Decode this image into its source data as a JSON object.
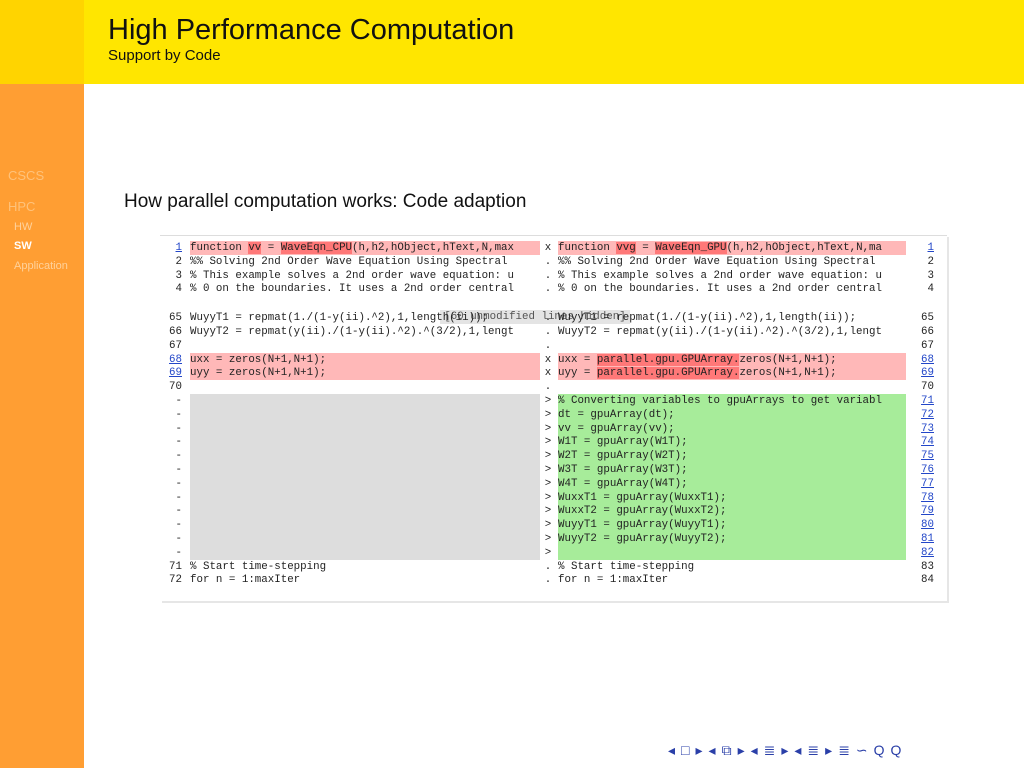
{
  "header": {
    "title": "High Performance Computation",
    "subtitle": "Support by Code"
  },
  "nav": {
    "sections": [
      "CSCS",
      "HPC"
    ],
    "subsections": [
      "HW",
      "SW",
      "Application"
    ],
    "active": "SW"
  },
  "frame": {
    "heading": "How parallel computation works: Code adaption"
  },
  "diff": {
    "hidden_note": "[60 unmodified lines hidden]",
    "rows": [
      {
        "l": "1",
        "lt": "function vv = WaveEqn_CPU(h,h2,hObject,hText,N,max",
        "m": "x",
        "rt": "function vvg = WaveEqn_GPU(h,h2,hObject,hText,N,ma",
        "r": "1"
      },
      {
        "l": "2",
        "lt": "%% Solving 2nd Order Wave Equation Using Spectral",
        "m": ".",
        "rt": "%% Solving 2nd Order Wave Equation Using Spectral",
        "r": "2"
      },
      {
        "l": "3",
        "lt": "% This example solves a 2nd order wave equation: u",
        "m": ".",
        "rt": "% This example solves a 2nd order wave equation: u",
        "r": "3"
      },
      {
        "l": "4",
        "lt": "% 0 on the boundaries. It uses a 2nd order central",
        "m": ".",
        "rt": "% 0 on the boundaries. It uses a 2nd order central",
        "r": "4"
      },
      {
        "l": "65",
        "lt": "WuyyT1 = repmat(1./(1-y(ii).^2),1,length(ii));",
        "m": ".",
        "rt": "WuyyT1 = repmat(1./(1-y(ii).^2),1,length(ii));",
        "r": "65"
      },
      {
        "l": "66",
        "lt": "WuyyT2 = repmat(y(ii)./(1-y(ii).^2).^(3/2),1,lengt",
        "m": ".",
        "rt": "WuyyT2 = repmat(y(ii)./(1-y(ii).^2).^(3/2),1,lengt",
        "r": "66"
      },
      {
        "l": "67",
        "lt": "",
        "m": ".",
        "rt": "",
        "r": "67"
      },
      {
        "l": "68",
        "lt": "uxx = zeros(N+1,N+1);",
        "m": "x",
        "rt": "uxx = parallel.gpu.GPUArray.zeros(N+1,N+1);",
        "r": "68"
      },
      {
        "l": "69",
        "lt": "uyy = zeros(N+1,N+1);",
        "m": "x",
        "rt": "uyy = parallel.gpu.GPUArray.zeros(N+1,N+1);",
        "r": "69"
      },
      {
        "l": "70",
        "lt": "",
        "m": ".",
        "rt": "",
        "r": "70"
      },
      {
        "l": "-",
        "lt": "",
        "m": ">",
        "rt": "% Converting variables to gpuArrays to get variabl",
        "r": "71"
      },
      {
        "l": "-",
        "lt": "",
        "m": ">",
        "rt": "dt = gpuArray(dt);",
        "r": "72"
      },
      {
        "l": "-",
        "lt": "",
        "m": ">",
        "rt": "vv = gpuArray(vv);",
        "r": "73"
      },
      {
        "l": "-",
        "lt": "",
        "m": ">",
        "rt": "W1T = gpuArray(W1T);",
        "r": "74"
      },
      {
        "l": "-",
        "lt": "",
        "m": ">",
        "rt": "W2T = gpuArray(W2T);",
        "r": "75"
      },
      {
        "l": "-",
        "lt": "",
        "m": ">",
        "rt": "W3T = gpuArray(W3T);",
        "r": "76"
      },
      {
        "l": "-",
        "lt": "",
        "m": ">",
        "rt": "W4T = gpuArray(W4T);",
        "r": "77"
      },
      {
        "l": "-",
        "lt": "",
        "m": ">",
        "rt": "WuxxT1 = gpuArray(WuxxT1);",
        "r": "78"
      },
      {
        "l": "-",
        "lt": "",
        "m": ">",
        "rt": "WuxxT2 = gpuArray(WuxxT2);",
        "r": "79"
      },
      {
        "l": "-",
        "lt": "",
        "m": ">",
        "rt": "WuyyT1 = gpuArray(WuyyT1);",
        "r": "80"
      },
      {
        "l": "-",
        "lt": "",
        "m": ">",
        "rt": "WuyyT2 = gpuArray(WuyyT2);",
        "r": "81"
      },
      {
        "l": "-",
        "lt": "",
        "m": ">",
        "rt": "",
        "r": "82"
      },
      {
        "l": "71",
        "lt": "% Start time-stepping",
        "m": ".",
        "rt": "% Start time-stepping",
        "r": "83"
      },
      {
        "l": "72",
        "lt": "for n = 1:maxIter",
        "m": ".",
        "rt": "for n = 1:maxIter",
        "r": "84"
      }
    ]
  },
  "controls": [
    "◂",
    "□",
    "▸",
    "◂",
    "⧉",
    "▸",
    "◂",
    "≣",
    "▸",
    "◂",
    "≣",
    "▸",
    "≣",
    "∽",
    "Q",
    "Q"
  ],
  "colors": {
    "header": "#ffe600",
    "sidebar": "#ff9e33",
    "deleted": "#ffb8b8",
    "added": "#a7ec9a",
    "changed_token": "#ff7878"
  }
}
